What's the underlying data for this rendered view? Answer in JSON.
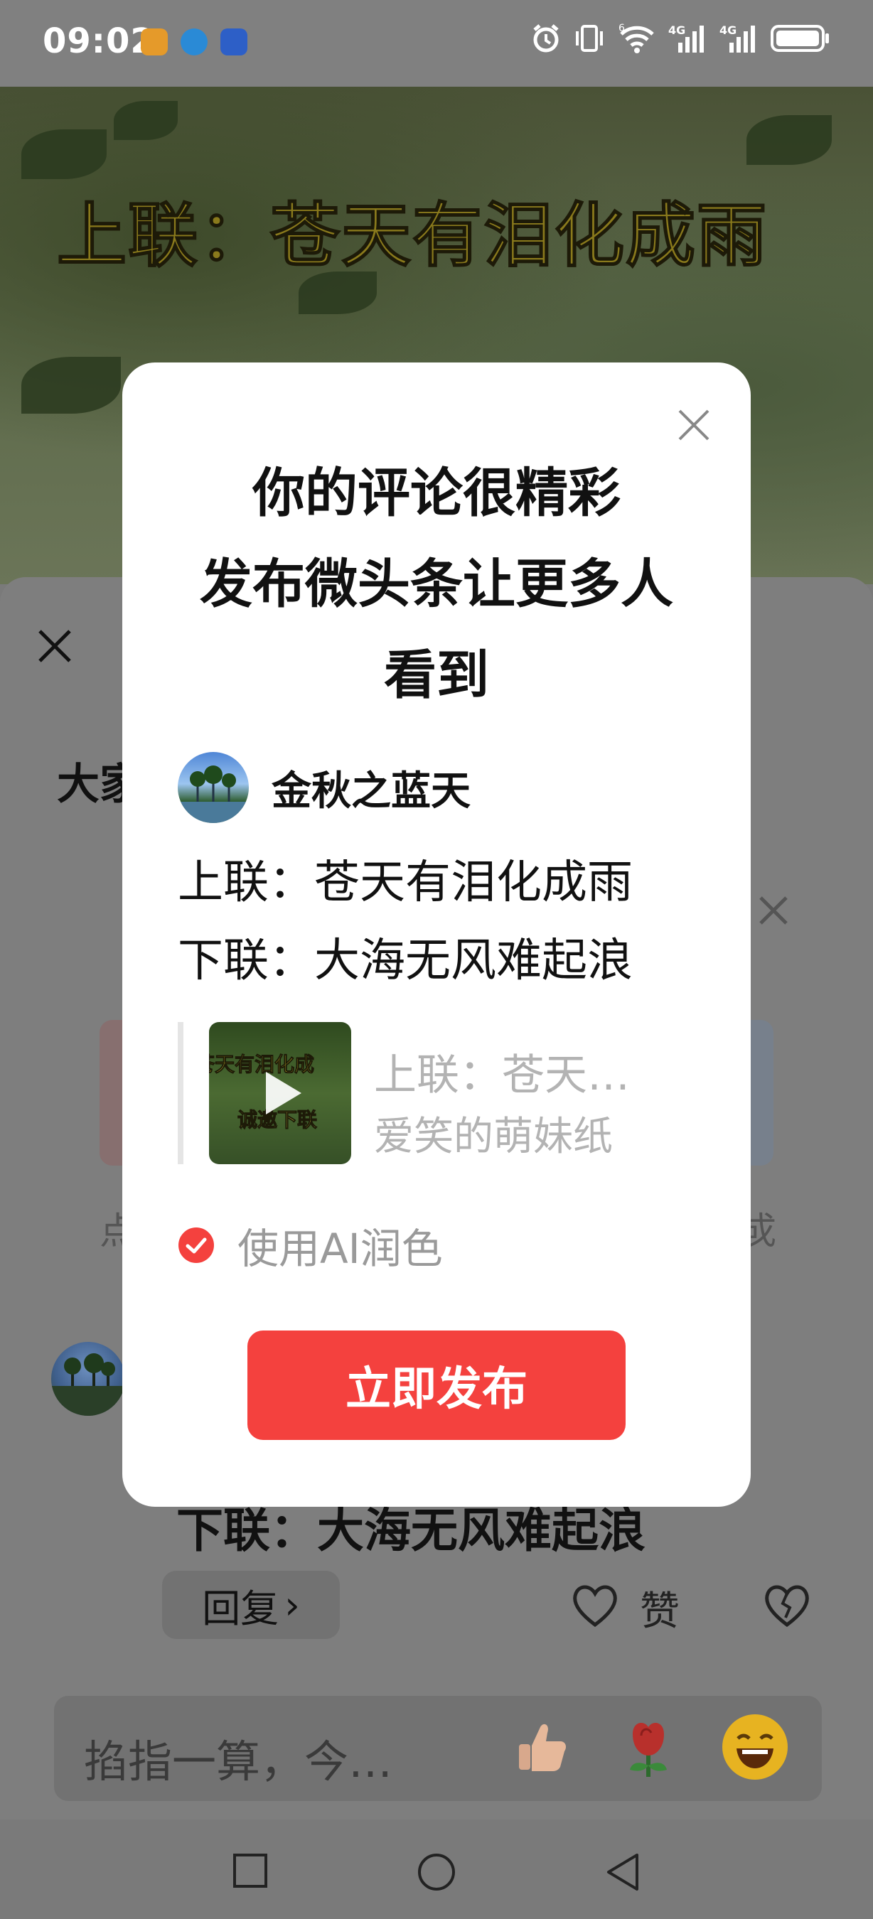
{
  "status_bar": {
    "time": "09:02",
    "icons": [
      "app-orange-icon",
      "message-bubble-icon",
      "baidu-paw-icon",
      "alarm-icon",
      "vibrate-icon",
      "wifi-icon",
      "signal-4g-icon",
      "signal-4g-icon",
      "battery-icon"
    ],
    "network_labels": [
      "6",
      "4G",
      "4G"
    ]
  },
  "video": {
    "title": "上联：苍天有泪化成雨"
  },
  "sheet": {
    "heading_partial": "大家",
    "left_char": "点",
    "right_char": "戓",
    "comment_line2": "下联：大海无风难起浪",
    "reply_label": "回复",
    "reply_chevron": "›",
    "like_label": "赞"
  },
  "input_bar": {
    "placeholder": "掐指一算，今…",
    "emojis": [
      "thumbs-up-icon",
      "rose-icon",
      "laughing-face-icon"
    ]
  },
  "modal": {
    "title_lines": [
      "你的评论很精彩",
      "发布微头条让更多人",
      "看到"
    ],
    "author": "金秋之蓝天",
    "couplet_line1": "上联：苍天有泪化成雨",
    "couplet_line2": "下联：大海无风难起浪",
    "quote": {
      "thumb_text1": "苍天有泪化成",
      "thumb_text2": "诚邀下联",
      "title": "上联：苍天…",
      "author": "爱笑的萌妹纸"
    },
    "ai_polish": {
      "label": "使用AI润色",
      "checked": true
    },
    "publish_button": "立即发布"
  },
  "colors": {
    "primary_red": "#f4413e",
    "overlay_gray": "#7e7e7e",
    "title_gold": "#8a7a1c"
  }
}
